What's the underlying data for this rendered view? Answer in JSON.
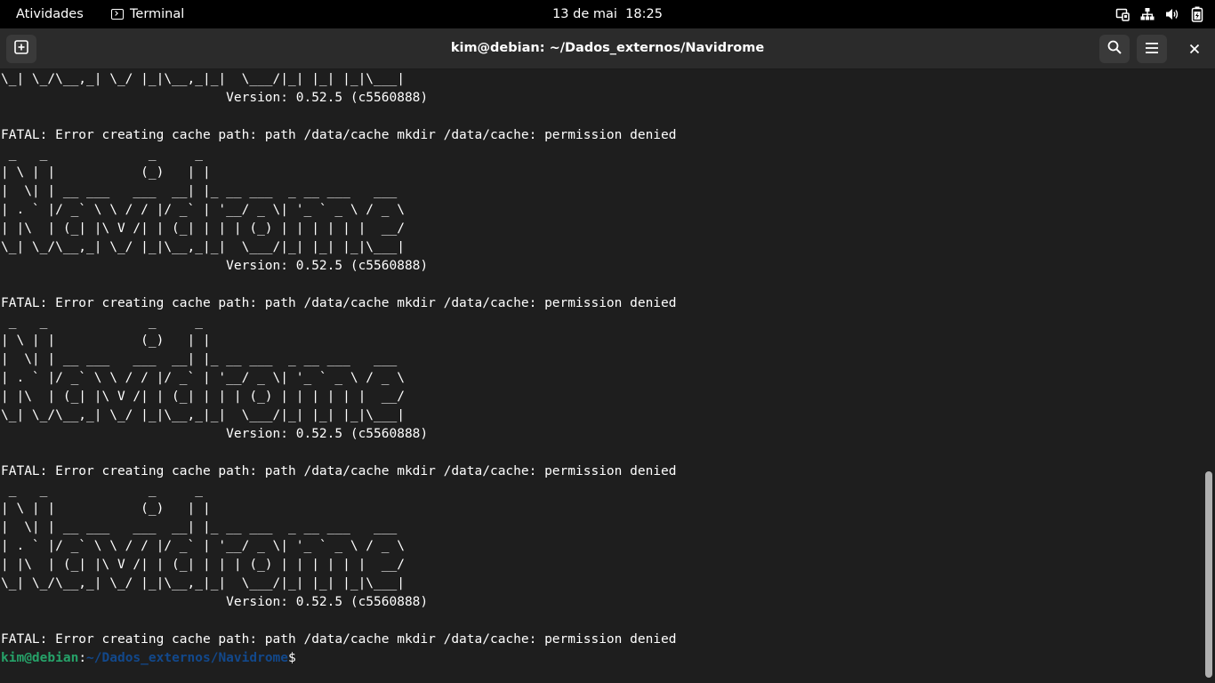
{
  "topbar": {
    "activities": "Atividades",
    "app_name": "Terminal",
    "app_icon": "terminal-icon",
    "clock": "13 de mai  18:25",
    "tray_icons": [
      "screen-share-icon",
      "network-icon",
      "volume-icon",
      "battery-icon"
    ]
  },
  "window": {
    "title": "kim@debian: ~/Dados_externos/Navidrome",
    "buttons": [
      "new-tab-icon",
      "search-icon",
      "hamburger-menu-icon",
      "close-icon"
    ]
  },
  "terminal": {
    "lines": [
      "\\_| \\_/\\__,_| \\_/ |_|\\__,_|_|  \\___/|_| |_| |_|\\___|",
      "                             Version: 0.52.5 (c5560888)",
      "",
      "FATAL: Error creating cache path: path /data/cache mkdir /data/cache: permission denied",
      " _   _             _     _",
      "| \\ | |           (_)   | |",
      "|  \\| | __ ___   ___  __| |_ __ ___  _ __ ___   ___",
      "| . ` |/ _` \\ \\ / / |/ _` | '__/ _ \\| '_ ` _ \\ / _ \\",
      "| |\\  | (_| |\\ V /| | (_| | | | (_) | | | | | |  __/",
      "\\_| \\_/\\__,_| \\_/ |_|\\__,_|_|  \\___/|_| |_| |_|\\___|",
      "                             Version: 0.52.5 (c5560888)",
      "",
      "FATAL: Error creating cache path: path /data/cache mkdir /data/cache: permission denied",
      " _   _             _     _",
      "| \\ | |           (_)   | |",
      "|  \\| | __ ___   ___  __| |_ __ ___  _ __ ___   ___",
      "| . ` |/ _` \\ \\ / / |/ _` | '__/ _ \\| '_ ` _ \\ / _ \\",
      "| |\\  | (_| |\\ V /| | (_| | | | (_) | | | | | |  __/",
      "\\_| \\_/\\__,_| \\_/ |_|\\__,_|_|  \\___/|_| |_| |_|\\___|",
      "                             Version: 0.52.5 (c5560888)",
      "",
      "FATAL: Error creating cache path: path /data/cache mkdir /data/cache: permission denied",
      " _   _             _     _",
      "| \\ | |           (_)   | |",
      "|  \\| | __ ___   ___  __| |_ __ ___  _ __ ___   ___",
      "| . ` |/ _` \\ \\ / / |/ _` | '__/ _ \\| '_ ` _ \\ / _ \\",
      "| |\\  | (_| |\\ V /| | (_| | | | (_) | | | | | |  __/",
      "\\_| \\_/\\__,_| \\_/ |_|\\__,_|_|  \\___/|_| |_| |_|\\___|",
      "                             Version: 0.52.5 (c5560888)",
      "",
      "FATAL: Error creating cache path: path /data/cache mkdir /data/cache: permission denied"
    ],
    "prompt": {
      "user_host": "kim@debian",
      "colon": ":",
      "path": "~/Dados_externos/Navidrome",
      "symbol": "$"
    },
    "colors": {
      "background": "#1e1e1e",
      "foreground": "#ffffff",
      "prompt_user": "#26a269",
      "prompt_path": "#12488b"
    }
  }
}
